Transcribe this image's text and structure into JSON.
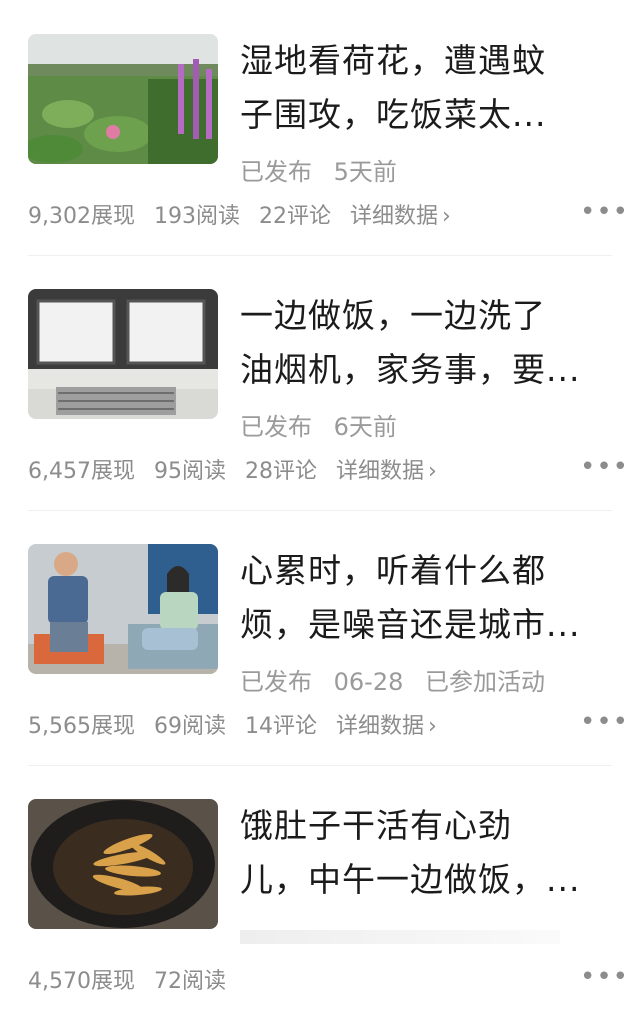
{
  "articles": [
    {
      "title_line1": "湿地看荷花，遭遇蚊",
      "title_line2": "子围攻，吃饭菜太...",
      "status": "已发布",
      "time": "5天前",
      "extra": "",
      "views": "9,302展现",
      "reads": "193阅读",
      "comments": "22评论",
      "detail_label": "详细数据",
      "thumb": "lotus-pond"
    },
    {
      "title_line1": "一边做饭，一边洗了",
      "title_line2": "油烟机，家务事，要...",
      "status": "已发布",
      "time": "6天前",
      "extra": "",
      "views": "6,457展现",
      "reads": "95阅读",
      "comments": "28评论",
      "detail_label": "详细数据",
      "thumb": "range-hood"
    },
    {
      "title_line1": "心累时，听着什么都",
      "title_line2": "烦，是噪音还是城市...",
      "status": "已发布",
      "time": "06-28",
      "extra": "已参加活动",
      "views": "5,565展现",
      "reads": "69阅读",
      "comments": "14评论",
      "detail_label": "详细数据",
      "thumb": "two-people-talking"
    },
    {
      "title_line1": "饿肚子干活有心劲",
      "title_line2": "儿，中午一边做饭，...",
      "status": "",
      "time": "",
      "extra": "",
      "views": "4,570展现",
      "reads": "72阅读",
      "comments": "",
      "detail_label": "",
      "thumb": "fried-fish-wok"
    }
  ],
  "more_label": "•••"
}
